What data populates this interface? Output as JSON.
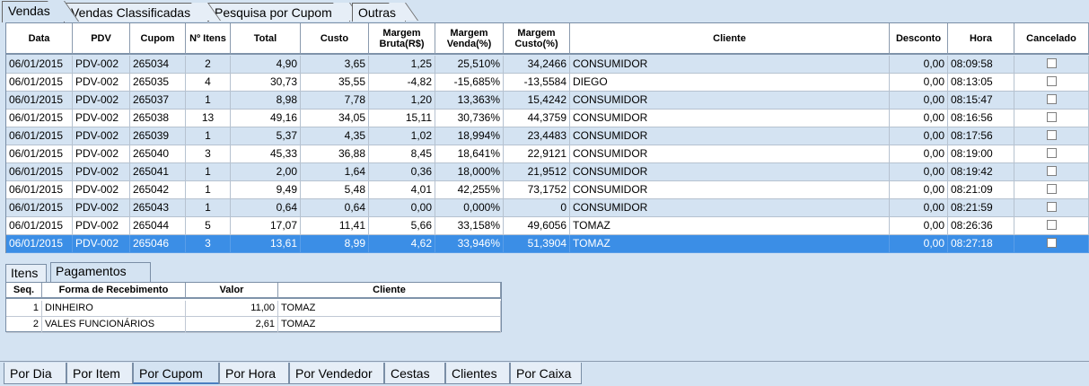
{
  "top_tabs": [
    "Vendas",
    "Vendas Classificadas",
    "Pesquisa por Cupom",
    "Outras"
  ],
  "columns": [
    "Data",
    "PDV",
    "Cupom",
    "Nº Itens",
    "Total",
    "Custo",
    "Margem Bruta(R$)",
    "Margem Venda(%)",
    "Margem Custo(%)",
    "Cliente",
    "Desconto",
    "Hora",
    "Cancelado"
  ],
  "rows": [
    {
      "data": "06/01/2015",
      "pdv": "PDV-002",
      "cupom": "265034",
      "itens": "2",
      "total": "4,90",
      "custo": "3,65",
      "mbruta": "1,25",
      "mvenda": "25,510%",
      "mcusto": "34,2466",
      "cliente": "CONSUMIDOR",
      "desconto": "0,00",
      "hora": "08:09:58"
    },
    {
      "data": "06/01/2015",
      "pdv": "PDV-002",
      "cupom": "265035",
      "itens": "4",
      "total": "30,73",
      "custo": "35,55",
      "mbruta": "-4,82",
      "mvenda": "-15,685%",
      "mcusto": "-13,5584",
      "cliente": "DIEGO",
      "desconto": "0,00",
      "hora": "08:13:05"
    },
    {
      "data": "06/01/2015",
      "pdv": "PDV-002",
      "cupom": "265037",
      "itens": "1",
      "total": "8,98",
      "custo": "7,78",
      "mbruta": "1,20",
      "mvenda": "13,363%",
      "mcusto": "15,4242",
      "cliente": "CONSUMIDOR",
      "desconto": "0,00",
      "hora": "08:15:47"
    },
    {
      "data": "06/01/2015",
      "pdv": "PDV-002",
      "cupom": "265038",
      "itens": "13",
      "total": "49,16",
      "custo": "34,05",
      "mbruta": "15,11",
      "mvenda": "30,736%",
      "mcusto": "44,3759",
      "cliente": "CONSUMIDOR",
      "desconto": "0,00",
      "hora": "08:16:56"
    },
    {
      "data": "06/01/2015",
      "pdv": "PDV-002",
      "cupom": "265039",
      "itens": "1",
      "total": "5,37",
      "custo": "4,35",
      "mbruta": "1,02",
      "mvenda": "18,994%",
      "mcusto": "23,4483",
      "cliente": "CONSUMIDOR",
      "desconto": "0,00",
      "hora": "08:17:56"
    },
    {
      "data": "06/01/2015",
      "pdv": "PDV-002",
      "cupom": "265040",
      "itens": "3",
      "total": "45,33",
      "custo": "36,88",
      "mbruta": "8,45",
      "mvenda": "18,641%",
      "mcusto": "22,9121",
      "cliente": "CONSUMIDOR",
      "desconto": "0,00",
      "hora": "08:19:00"
    },
    {
      "data": "06/01/2015",
      "pdv": "PDV-002",
      "cupom": "265041",
      "itens": "1",
      "total": "2,00",
      "custo": "1,64",
      "mbruta": "0,36",
      "mvenda": "18,000%",
      "mcusto": "21,9512",
      "cliente": "CONSUMIDOR",
      "desconto": "0,00",
      "hora": "08:19:42"
    },
    {
      "data": "06/01/2015",
      "pdv": "PDV-002",
      "cupom": "265042",
      "itens": "1",
      "total": "9,49",
      "custo": "5,48",
      "mbruta": "4,01",
      "mvenda": "42,255%",
      "mcusto": "73,1752",
      "cliente": "CONSUMIDOR",
      "desconto": "0,00",
      "hora": "08:21:09"
    },
    {
      "data": "06/01/2015",
      "pdv": "PDV-002",
      "cupom": "265043",
      "itens": "1",
      "total": "0,64",
      "custo": "0,64",
      "mbruta": "0,00",
      "mvenda": "0,000%",
      "mcusto": "0",
      "cliente": "CONSUMIDOR",
      "desconto": "0,00",
      "hora": "08:21:59"
    },
    {
      "data": "06/01/2015",
      "pdv": "PDV-002",
      "cupom": "265044",
      "itens": "5",
      "total": "17,07",
      "custo": "11,41",
      "mbruta": "5,66",
      "mvenda": "33,158%",
      "mcusto": "49,6056",
      "cliente": "TOMAZ",
      "desconto": "0,00",
      "hora": "08:26:36"
    },
    {
      "data": "06/01/2015",
      "pdv": "PDV-002",
      "cupom": "265046",
      "itens": "3",
      "total": "13,61",
      "custo": "8,99",
      "mbruta": "4,62",
      "mvenda": "33,946%",
      "mcusto": "51,3904",
      "cliente": "TOMAZ",
      "desconto": "0,00",
      "hora": "08:27:18",
      "selected": true
    }
  ],
  "mid_tabs": [
    "Itens",
    "Pagamentos"
  ],
  "payments": {
    "columns": [
      "Seq.",
      "Forma de Recebimento",
      "Valor",
      "Cliente"
    ],
    "rows": [
      {
        "seq": "1",
        "forma": "DINHEIRO",
        "valor": "11,00",
        "cliente": "TOMAZ"
      },
      {
        "seq": "2",
        "forma": "VALES FUNCIONÁRIOS",
        "valor": "2,61",
        "cliente": "TOMAZ"
      }
    ]
  },
  "bottom_tabs": [
    "Por Dia",
    "Por Item",
    "Por Cupom",
    "Por Hora",
    "Por Vendedor",
    "Cestas",
    "Clientes",
    "Por Caixa"
  ],
  "colors": {
    "selected_row": "#3b8ee6",
    "alt_row": "#d4e3f2",
    "background": "#d4e3f2"
  }
}
